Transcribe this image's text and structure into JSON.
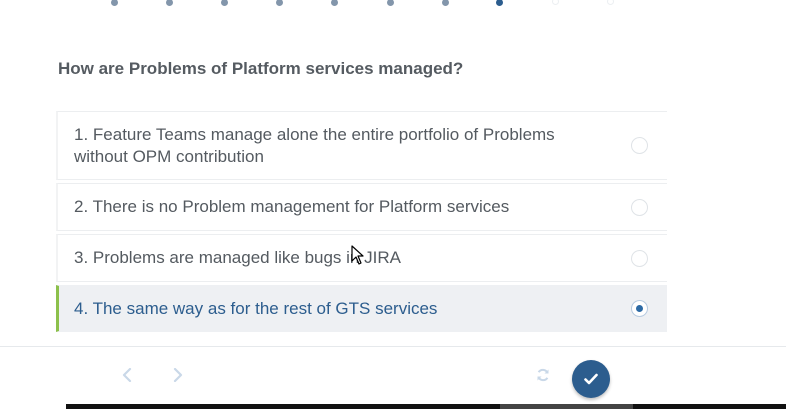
{
  "progress": {
    "total_steps": 10,
    "current_step": 8
  },
  "question": "How are Problems of Platform services managed?",
  "answers": [
    {
      "label": "1. Feature Teams manage alone the entire portfolio of Problems without OPM contribution",
      "selected": false
    },
    {
      "label": "2. There is no Problem management for Platform services",
      "selected": false
    },
    {
      "label": "3. Problems are managed like bugs in JIRA",
      "selected": false
    },
    {
      "label": "4. The same way as for the rest of GTS services",
      "selected": true
    }
  ],
  "footer": {
    "prev_icon": "chevron-left-icon",
    "next_icon": "chevron-right-icon",
    "reset_icon": "refresh-icon",
    "submit_icon": "checkmark-icon"
  },
  "colors": {
    "accent": "#2c5d8e",
    "selected_bar": "#8cc04b",
    "selected_bg": "#eef0f3"
  }
}
